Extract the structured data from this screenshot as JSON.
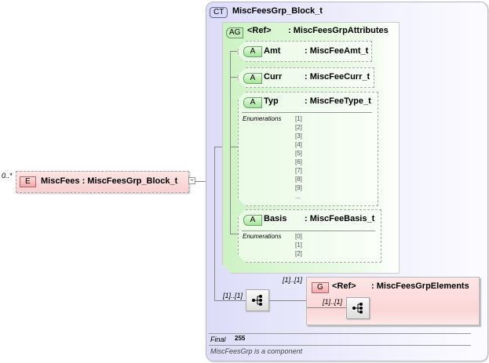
{
  "element": {
    "occurs": "0..*",
    "badge": "E",
    "label": "MiscFees : MiscFeesGrp_Block_t"
  },
  "complex_type": {
    "badge": "CT",
    "name": "MiscFeesGrp_Block_t"
  },
  "attribute_group": {
    "badge": "AG",
    "ref": "<Ref>",
    "type": ": MiscFeesGrpAttributes",
    "attributes": [
      {
        "badge": "A",
        "name": "Amt",
        "type": ": MiscFeeAmt_t"
      },
      {
        "badge": "A",
        "name": "Curr",
        "type": ": MiscFeeCurr_t"
      },
      {
        "badge": "A",
        "name": "Typ",
        "type": ": MiscFeeType_t",
        "enum_label": "Enumerations",
        "enums": [
          "[1]",
          "[2]",
          "[3]",
          "[4]",
          "[5]",
          "[6]",
          "[7]",
          "[8]",
          "[9]",
          "..."
        ]
      },
      {
        "badge": "A",
        "name": "Basis",
        "type": ": MiscFeeBasis_t",
        "enum_label": "Enumerations",
        "enums": [
          "[0]",
          "[1]",
          "[2]"
        ]
      }
    ]
  },
  "sequence": {
    "occurs": "[1]..[1]",
    "icon": "sequence-icon"
  },
  "group": {
    "occurs": "[1]..[1]",
    "badge": "G",
    "ref": "<Ref>",
    "type": ": MiscFeesGrpElements",
    "inner_occurs": "[1]..[1]"
  },
  "properties": {
    "final_label": "Final",
    "final_value": "255",
    "note": "MiscFeesGrp is a component"
  }
}
